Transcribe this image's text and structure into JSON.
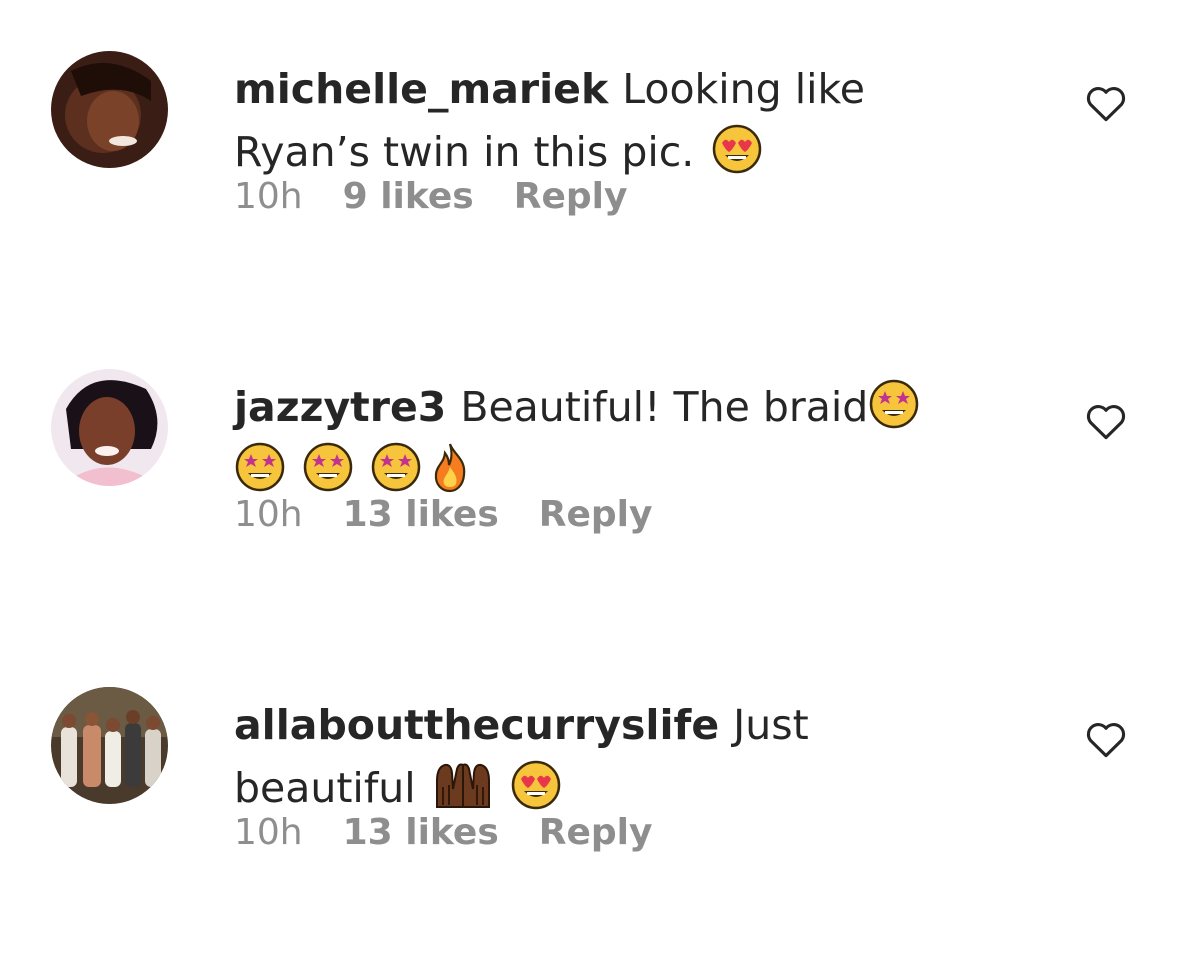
{
  "comments": [
    {
      "username": "michelle_mariek",
      "text_line1": "Looking like",
      "text_line2": "Ryan’s twin in this pic.",
      "emojis_line1": [],
      "emojis_line2": [
        "heart-eyes-emoji"
      ],
      "time": "10h",
      "likes": "9 likes",
      "reply": "Reply"
    },
    {
      "username": "jazzytre3",
      "text_line1": "Beautiful! The braid",
      "text_line2": "",
      "emojis_line1": [
        "star-struck-emoji"
      ],
      "emojis_line2": [
        "star-struck-emoji",
        "star-struck-emoji",
        "star-struck-emoji",
        "fire-emoji"
      ],
      "time": "10h",
      "likes": "13 likes",
      "reply": "Reply"
    },
    {
      "username": "allaboutthecurryslife",
      "text_line1": "Just",
      "text_line2": "beautiful",
      "emojis_line1": [],
      "emojis_line2": [
        "raising-hands-emoji",
        "heart-eyes-emoji"
      ],
      "time": "10h",
      "likes": "13 likes",
      "reply": "Reply"
    }
  ],
  "icons": {
    "like": "heart-outline-icon"
  },
  "colors": {
    "text": "#262626",
    "meta": "#8e8e8e",
    "emoji_face": "#f7c53b",
    "emoji_heart": "#e8374b",
    "emoji_star": "#c2338f",
    "fire": "#f57c1f"
  }
}
